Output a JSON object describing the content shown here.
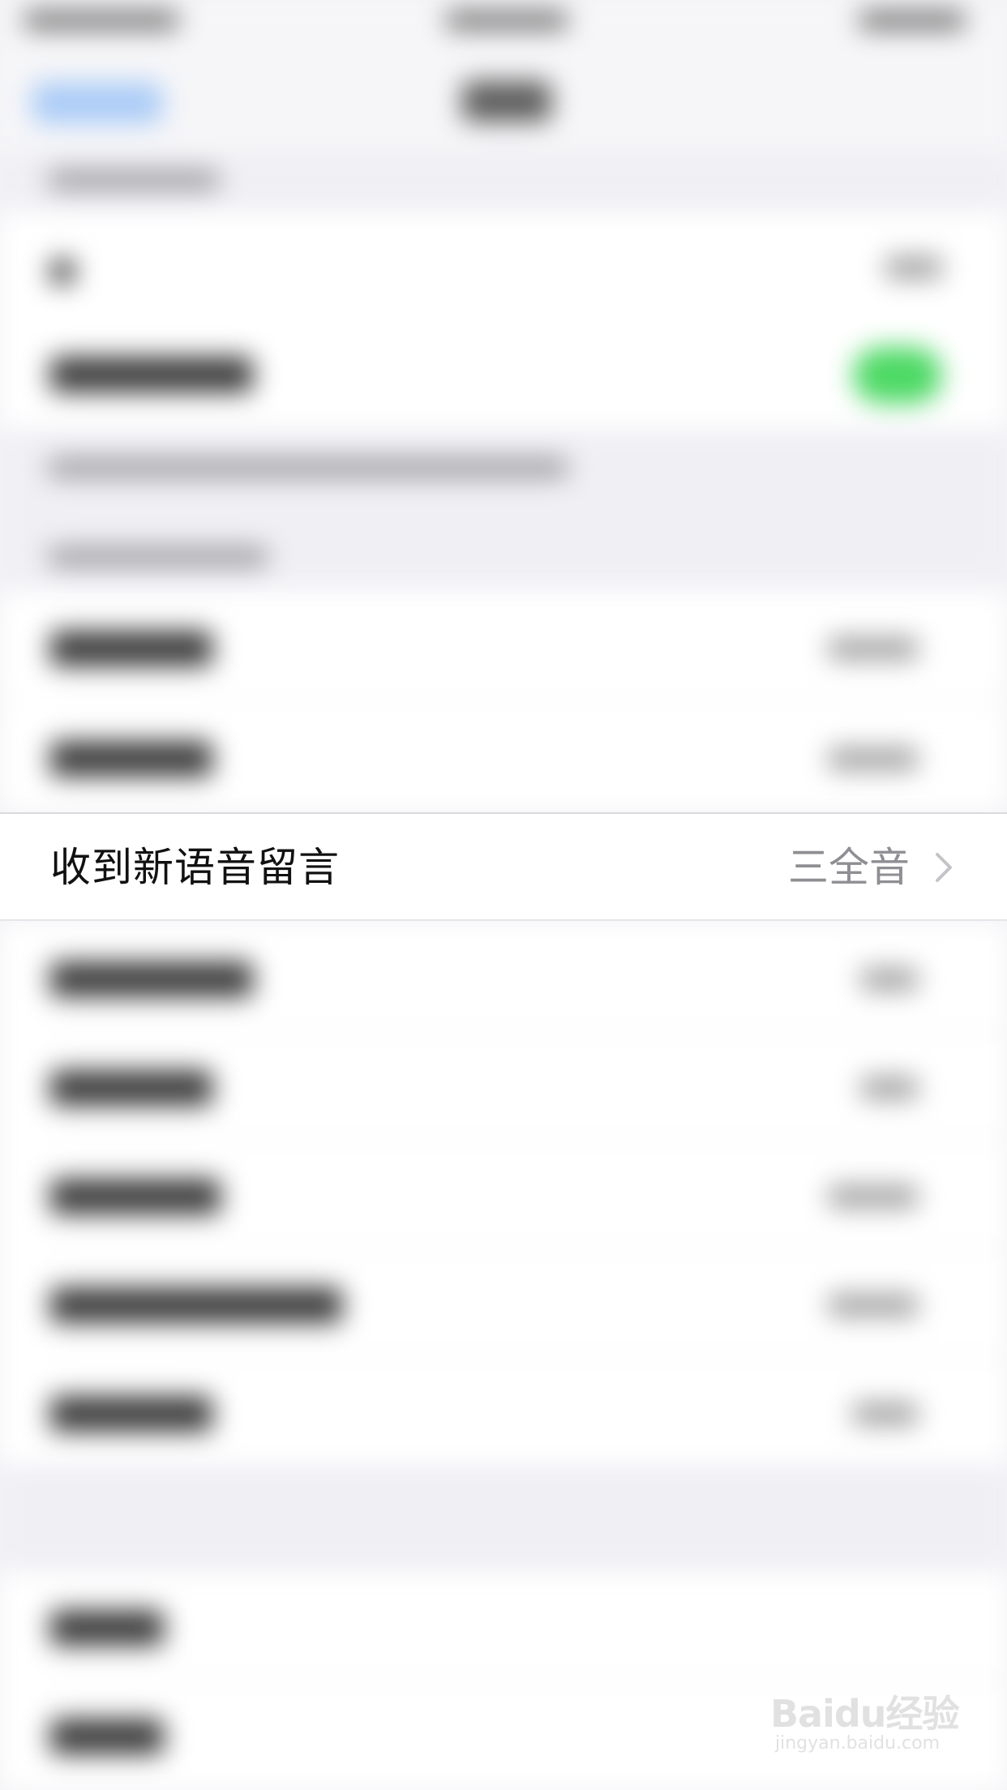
{
  "focused_row": {
    "label": "收到新语音留言",
    "value": "三全音"
  },
  "watermark": {
    "logo": "Baidu经验",
    "url": "jingyan.baidu.com"
  },
  "colors": {
    "toggle_on": "#4cd964",
    "nav_accent": "#a9cbf7",
    "value_text": "#8e8e93"
  }
}
